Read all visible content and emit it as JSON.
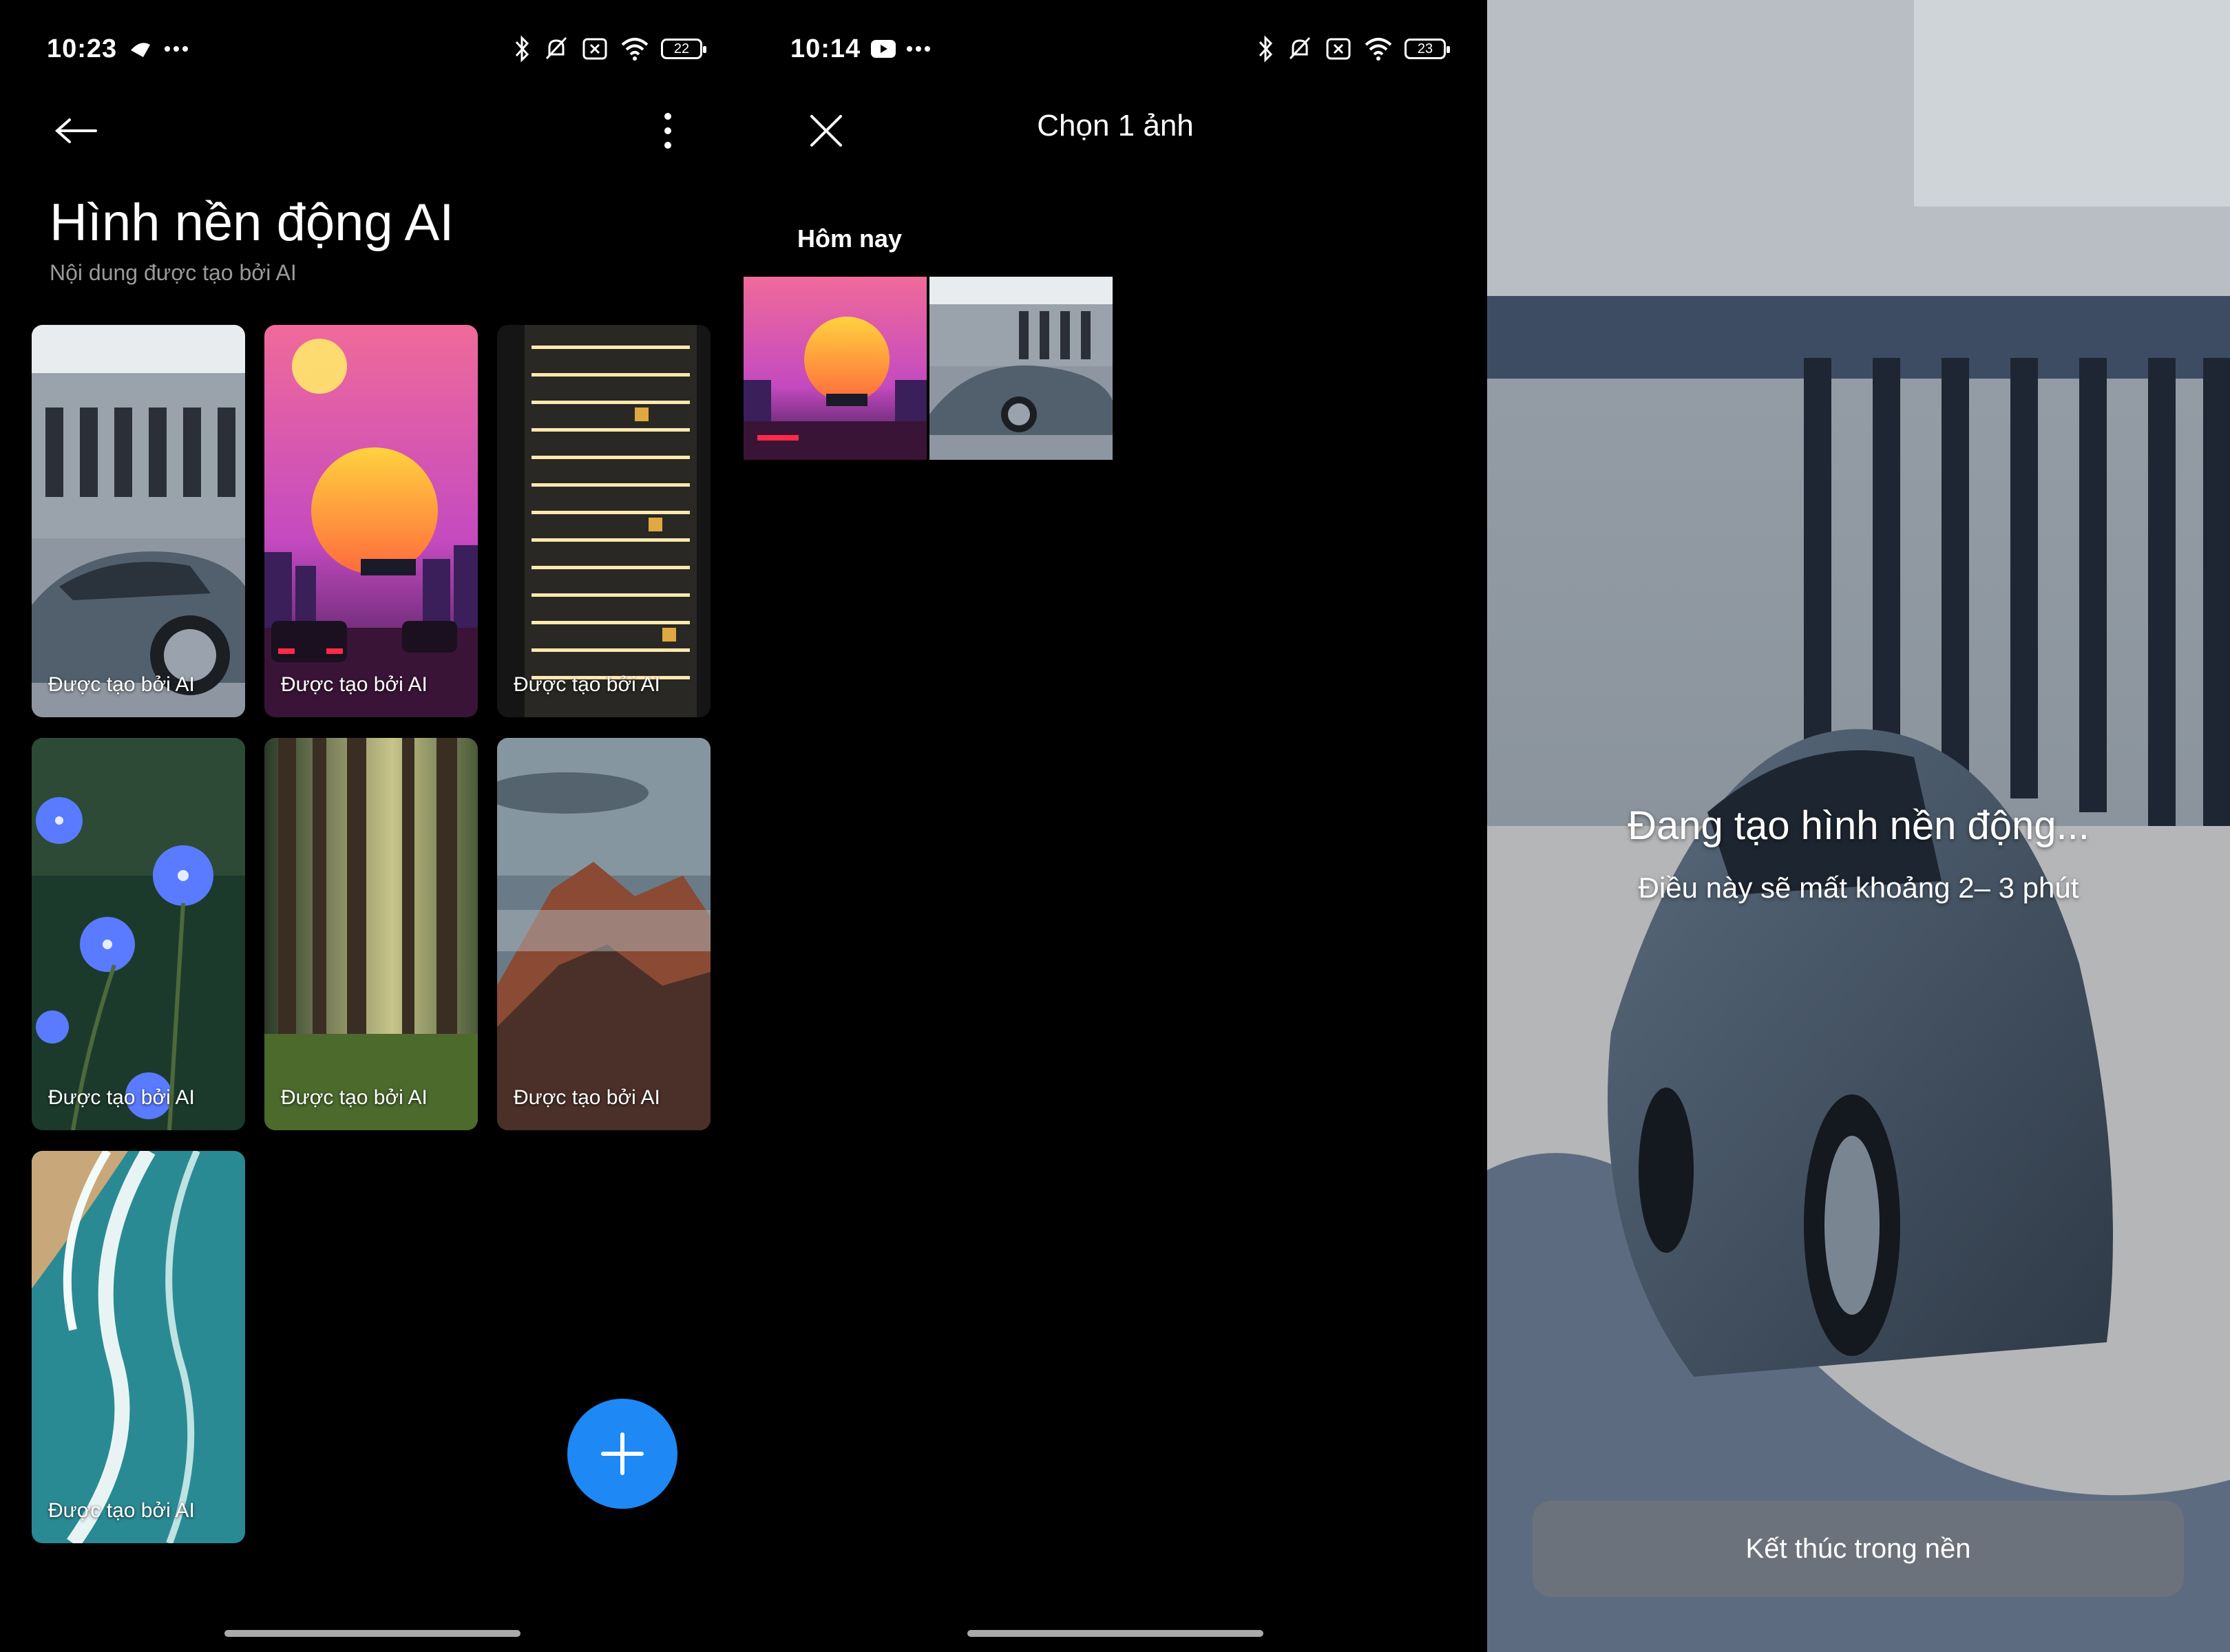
{
  "panel1": {
    "status": {
      "time": "10:23",
      "battery": "22"
    },
    "title": "Hình nền động AI",
    "subtitle": "Nội dung được tạo bởi AI",
    "cards": [
      {
        "label": "Được tạo bởi AI",
        "subject": "car"
      },
      {
        "label": "Được tạo bởi AI",
        "subject": "synthwave-sunset"
      },
      {
        "label": "Được tạo bởi AI",
        "subject": "night-tower"
      },
      {
        "label": "Được tạo bởi AI",
        "subject": "blue-flowers"
      },
      {
        "label": "Được tạo bởi AI",
        "subject": "forest"
      },
      {
        "label": "Được tạo bởi AI",
        "subject": "mountain"
      },
      {
        "label": "Được tạo bởi AI",
        "subject": "ocean-waves"
      }
    ]
  },
  "panel2": {
    "status": {
      "time": "10:14",
      "battery": "23"
    },
    "title": "Chọn 1 ảnh",
    "section": "Hôm nay"
  },
  "panel3": {
    "loading_title": "Đang tạo hình nền động...",
    "loading_sub": "Điều này sẽ mất khoảng 2– 3 phút",
    "button": "Kết thúc trong nền"
  },
  "colors": {
    "accent": "#1e88f5",
    "background": "#000000"
  }
}
